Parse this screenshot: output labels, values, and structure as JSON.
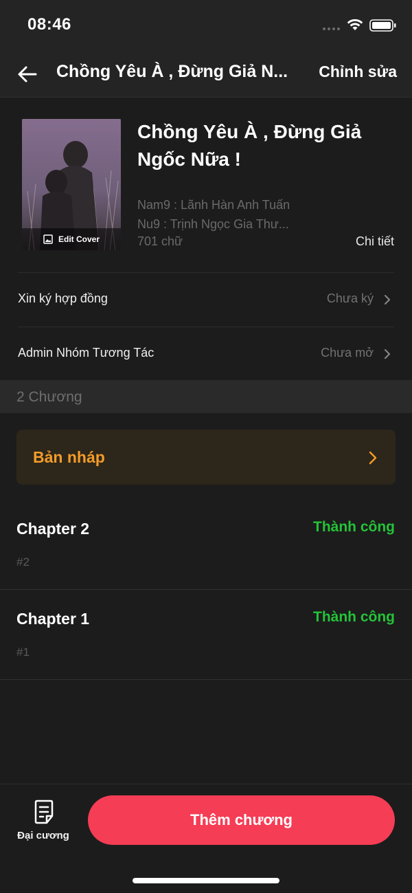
{
  "status_bar": {
    "time": "08:46"
  },
  "nav": {
    "title": "Chồng Yêu À , Đừng Giả N...",
    "edit_label": "Chỉnh sửa",
    "back_icon": "arrow-left-icon"
  },
  "book": {
    "title": "Chồng Yêu À , Đừng Giả Ngốc Nữa !",
    "edit_cover_label": "Edit Cover",
    "meta_lines": [
      "Nam9 : Lãnh Hàn Anh Tuấn",
      "Nu9 : Trịnh Ngọc Gia Thư...",
      "701 chữ"
    ],
    "detail_label": "Chi tiết"
  },
  "settings": [
    {
      "label": "Xin ký hợp đồng",
      "value": "Chưa ký"
    },
    {
      "label": "Admin Nhóm Tương Tác",
      "value": "Chưa mở"
    }
  ],
  "chapters": {
    "count_label": "2 Chương",
    "draft_label": "Bản nháp",
    "items": [
      {
        "name": "Chapter 2",
        "status": "Thành công",
        "number": "#2"
      },
      {
        "name": "Chapter 1",
        "status": "Thành công",
        "number": "#1"
      }
    ]
  },
  "bottom_bar": {
    "outline_label": "Đại cương",
    "add_chapter_label": "Thêm chương"
  },
  "colors": {
    "accent": "#f53d55",
    "draft": "#f39c29",
    "success": "#24c338",
    "background": "#1c1c1c"
  }
}
